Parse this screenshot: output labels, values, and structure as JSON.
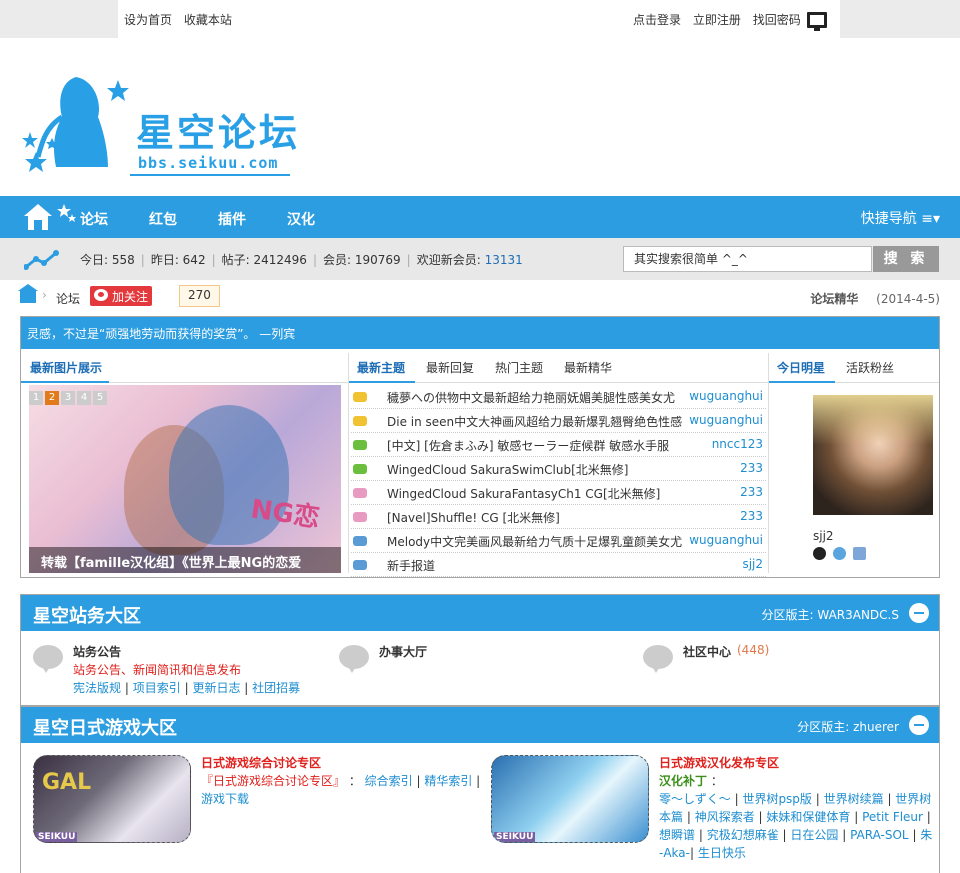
{
  "topbar": {
    "left_links": [
      "设为首页",
      "收藏本站"
    ],
    "right_links": [
      "点击登录",
      "立即注册",
      "找回密码"
    ]
  },
  "logo": {
    "title": "星空论坛",
    "url": "bbs.seikuu.com"
  },
  "nav": {
    "items": [
      "论坛",
      "红包",
      "插件",
      "汉化"
    ],
    "quick": "快捷导航 ≡▾"
  },
  "stats": {
    "today": "今日: 558",
    "yesterday": "昨日: 642",
    "posts": "帖子: 2412496",
    "members": "会员: 190769",
    "welcome": "欢迎新会员:",
    "newest": "13131"
  },
  "search": {
    "placeholder": "其实搜索很简单 ^_^",
    "button": "搜 索"
  },
  "crumb": {
    "forum": "论坛",
    "follow": "加关注",
    "follow_count": "270",
    "featured": "论坛精华",
    "date": "(2014-4-5)"
  },
  "motto": "灵感，不过是“顽强地劳动而获得的奖赏”。 —列宾",
  "left_tab": "最新图片展示",
  "pic_pages": [
    "1",
    "2",
    "3",
    "4",
    "5"
  ],
  "pic_caption": "转载【famille汉化组】《世界上最NG的恋爱",
  "pic_logo": "NG恋",
  "topic_tabs": [
    "最新主题",
    "最新回复",
    "热门主题",
    "最新精华"
  ],
  "topics": [
    {
      "title": "穢夢への供物中文最新超给力艳丽妩媚美腿性感美女尤",
      "author": "wuguanghui",
      "color": "#f1c232"
    },
    {
      "title": "Die in seen中文大神画风超给力最新爆乳翘臀绝色性感",
      "author": "wuguanghui",
      "color": "#f1c232"
    },
    {
      "title": "[中文] [佐倉まふみ] 敏感セーラー症候群 敏感水手服",
      "author": "nncc123",
      "color": "#6cbf3e"
    },
    {
      "title": "WingedCloud SakuraSwimClub[北米無修]",
      "author": "233",
      "color": "#6cbf3e"
    },
    {
      "title": "WingedCloud SakuraFantasyCh1 CG[北米無修]",
      "author": "233",
      "color": "#e89ac0"
    },
    {
      "title": "[Navel]Shuffle! CG [北米無修]",
      "author": "233",
      "color": "#e89ac0"
    },
    {
      "title": "Melody中文完美画风最新给力气质十足爆乳童颜美女尤",
      "author": "wuguanghui",
      "color": "#5a9bd5"
    },
    {
      "title": "新手报道",
      "author": "sjj2",
      "color": "#5a9bd5"
    }
  ],
  "star_tabs": [
    "今日明星",
    "活跃粉丝"
  ],
  "star_name": "sjj2",
  "sections": [
    {
      "title": "星空站务大区",
      "moderator": "分区版主: WAR3ANDC.S",
      "forums": [
        {
          "name": "站务公告",
          "desc": "站务公告、新闻简讯和信息发布",
          "links": [
            "宪法版规",
            "项目索引",
            "更新日志",
            "社团招募"
          ]
        },
        {
          "name": "办事大厅"
        },
        {
          "name": "社区中心",
          "count": "(448)"
        }
      ]
    },
    {
      "title": "星空日式游戏大区",
      "moderator": "分区版主: zhuerer",
      "forums": [
        {
          "name": "日式游戏综合讨论专区",
          "sub": "『日式游戏综合讨论专区』",
          "links": [
            "综合索引",
            "精华索引",
            "游戏下载"
          ],
          "thumb_text": "GAL",
          "thumb_mark": "SEIKUU"
        },
        {
          "name": "日式游戏汉化发布专区",
          "sub": "汉化补丁",
          "links": [
            "零～しずく～",
            "世界树psp版",
            "世界树续篇",
            "世界树本篇",
            "神风探索者",
            "妹妹和保健体育",
            "Petit Fleur",
            "想瞬谱",
            "究极幻想麻雀",
            "日在公园",
            "PARA-SOL",
            "朱 -Aka-",
            "生日快乐"
          ],
          "thumb_mark": "SEIKUU"
        }
      ]
    }
  ],
  "colors": {
    "accent": "#2b9de0",
    "link": "#1d8dd0",
    "red": "#e0201c",
    "green": "#3b8f1a"
  }
}
